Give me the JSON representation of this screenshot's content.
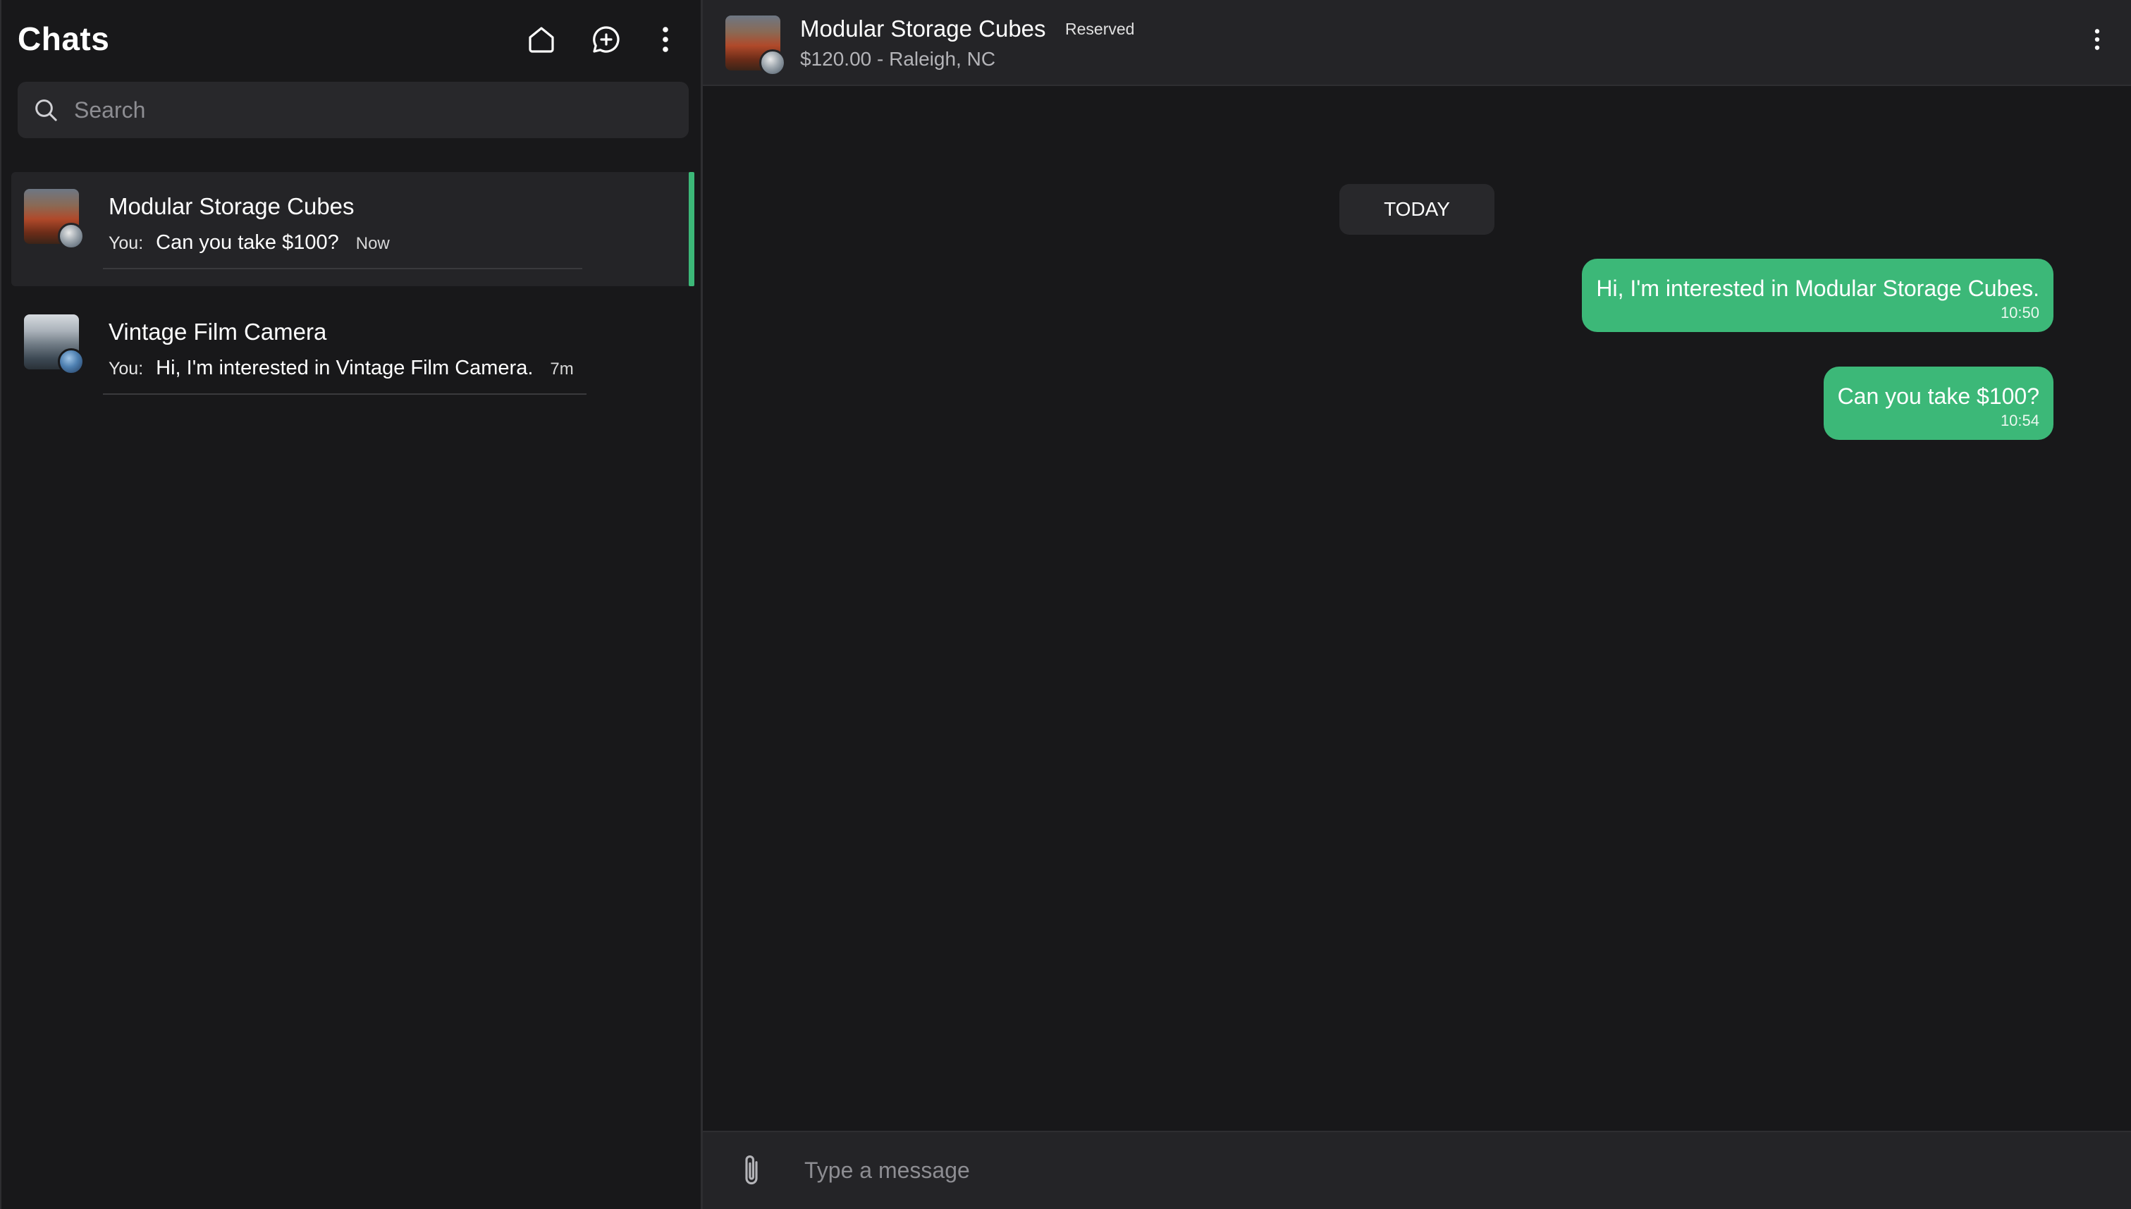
{
  "sidebar": {
    "title": "Chats",
    "icons": {
      "home": "home-icon",
      "new_chat": "new-chat-icon",
      "more": "more-vertical-icon"
    },
    "search": {
      "placeholder": "Search",
      "value": ""
    },
    "chats": [
      {
        "name": "Modular Storage Cubes",
        "sender": "You:",
        "last_message": "Can you take $100?",
        "time": "Now",
        "active": true
      },
      {
        "name": "Vintage Film Camera",
        "sender": "You:",
        "last_message": "Hi, I'm interested in Vintage Film Camera.",
        "time": "7m",
        "active": false
      }
    ]
  },
  "conversation": {
    "listing": {
      "title": "Modular Storage Cubes",
      "status": "Reserved",
      "subtitle": "$120.00 - Raleigh, NC"
    },
    "day_label": "TODAY",
    "messages": [
      {
        "text": "Hi, I'm interested in Modular Storage Cubes.",
        "time": "10:50",
        "outgoing": true
      },
      {
        "text": "Can you take $100?",
        "time": "10:54",
        "outgoing": true
      }
    ],
    "composer": {
      "placeholder": "Type a message",
      "value": ""
    }
  },
  "colors": {
    "accent": "#3cb878",
    "background": "#18181a",
    "panel": "#242427",
    "input": "#28282b"
  }
}
